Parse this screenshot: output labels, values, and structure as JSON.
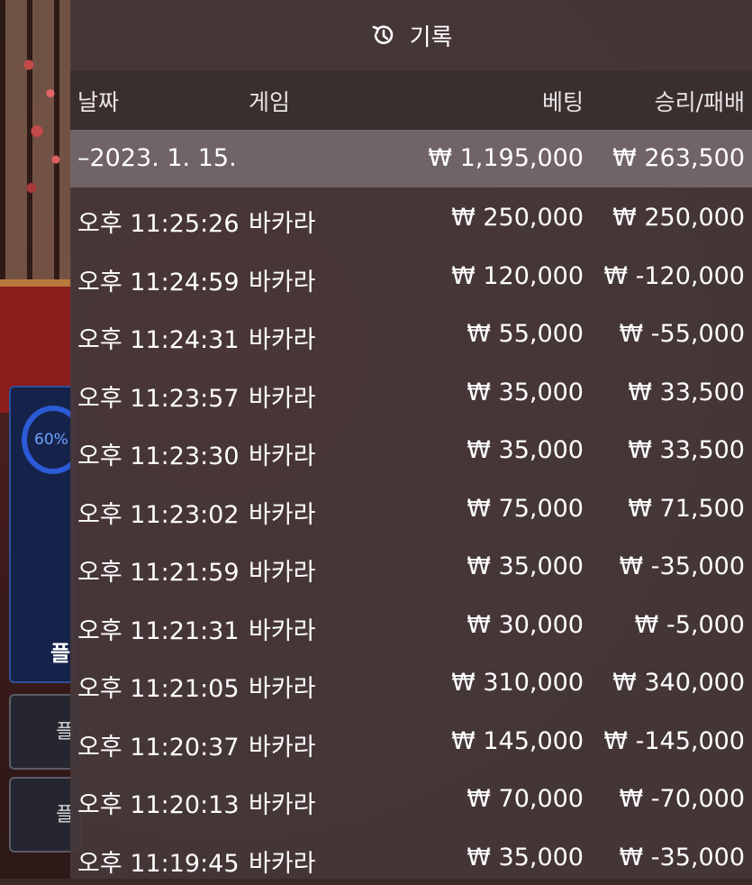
{
  "background": {
    "progress_text": "60%",
    "player_label": "플",
    "bet_buttons": [
      "플",
      "플"
    ]
  },
  "history": {
    "title": "기록",
    "icon": "history-icon",
    "columns": {
      "date": "날짜",
      "game": "게임",
      "bet": "베팅",
      "win_loss": "승리/패배"
    },
    "date_group": {
      "label": "–2023. 1. 15.",
      "bet_total": "₩ 1,195,000",
      "win_loss_total": "₩ 263,500"
    },
    "rows": [
      {
        "time": "오후 11:25:26",
        "game": "바카라",
        "bet": "₩ 250,000",
        "win_loss": "₩ 250,000"
      },
      {
        "time": "오후 11:24:59",
        "game": "바카라",
        "bet": "₩ 120,000",
        "win_loss": "₩ -120,000"
      },
      {
        "time": "오후 11:24:31",
        "game": "바카라",
        "bet": "₩ 55,000",
        "win_loss": "₩ -55,000"
      },
      {
        "time": "오후 11:23:57",
        "game": "바카라",
        "bet": "₩ 35,000",
        "win_loss": "₩ 33,500"
      },
      {
        "time": "오후 11:23:30",
        "game": "바카라",
        "bet": "₩ 35,000",
        "win_loss": "₩ 33,500"
      },
      {
        "time": "오후 11:23:02",
        "game": "바카라",
        "bet": "₩ 75,000",
        "win_loss": "₩ 71,500"
      },
      {
        "time": "오후 11:21:59",
        "game": "바카라",
        "bet": "₩ 35,000",
        "win_loss": "₩ -35,000"
      },
      {
        "time": "오후 11:21:31",
        "game": "바카라",
        "bet": "₩ 30,000",
        "win_loss": "₩ -5,000"
      },
      {
        "time": "오후 11:21:05",
        "game": "바카라",
        "bet": "₩ 310,000",
        "win_loss": "₩ 340,000"
      },
      {
        "time": "오후 11:20:37",
        "game": "바카라",
        "bet": "₩ 145,000",
        "win_loss": "₩ -145,000"
      },
      {
        "time": "오후 11:20:13",
        "game": "바카라",
        "bet": "₩ 70,000",
        "win_loss": "₩ -70,000"
      },
      {
        "time": "오후 11:19:45",
        "game": "바카라",
        "bet": "₩ 35,000",
        "win_loss": "₩ -35,000"
      }
    ]
  }
}
